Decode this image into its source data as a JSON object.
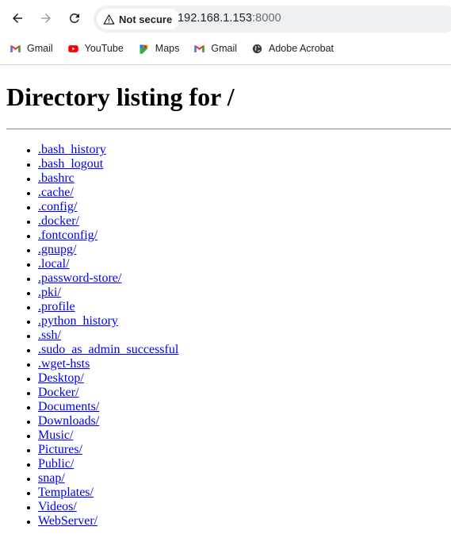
{
  "browser": {
    "security_label": "Not secure",
    "url_host": "192.168.1.153",
    "url_port": ":8000"
  },
  "bookmarks": [
    {
      "label": "Gmail",
      "icon": "gmail-icon"
    },
    {
      "label": "YouTube",
      "icon": "youtube-icon"
    },
    {
      "label": "Maps",
      "icon": "maps-icon"
    },
    {
      "label": "Gmail",
      "icon": "gmail-icon"
    },
    {
      "label": "Adobe Acrobat",
      "icon": "globe-icon"
    }
  ],
  "page": {
    "heading": "Directory listing for /",
    "entries": [
      ".bash_history",
      ".bash_logout",
      ".bashrc",
      ".cache/",
      ".config/",
      ".docker/",
      ".fontconfig/",
      ".gnupg/",
      ".local/",
      ".password-store/",
      ".pki/",
      ".profile",
      ".python_history",
      ".ssh/",
      ".sudo_as_admin_successful",
      ".wget-hsts",
      "Desktop/",
      "Docker/",
      "Documents/",
      "Downloads/",
      "Music/",
      "Pictures/",
      "Public/",
      "snap/",
      "Templates/",
      "Videos/",
      "WebServer/"
    ]
  }
}
